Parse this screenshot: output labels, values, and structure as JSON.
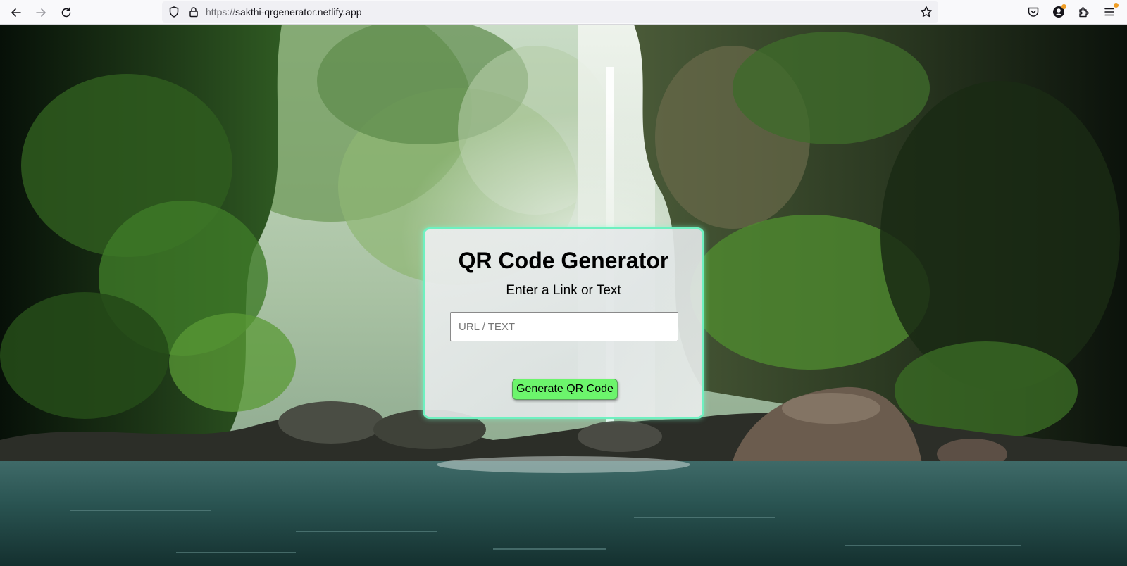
{
  "browser": {
    "url_scheme": "https://",
    "url_host": "sakthi-qrgenerator.netlify.app",
    "icons": {
      "back": "arrow-left-icon",
      "forward": "arrow-right-icon",
      "reload": "reload-icon",
      "shield": "tracking-shield-icon",
      "lock": "lock-icon",
      "bookmark": "star-icon",
      "pocket": "pocket-icon",
      "account": "account-icon",
      "extensions": "puzzle-icon",
      "menu": "hamburger-menu-icon"
    }
  },
  "page": {
    "background": "jungle waterfall photo",
    "card": {
      "title": "QR Code Generator",
      "subtitle": "Enter a Link or Text",
      "input": {
        "placeholder": "URL / TEXT",
        "value": ""
      },
      "button_label": "Generate QR Code",
      "border_color": "#6ff0c0",
      "button_color": "#6cf56c"
    }
  }
}
